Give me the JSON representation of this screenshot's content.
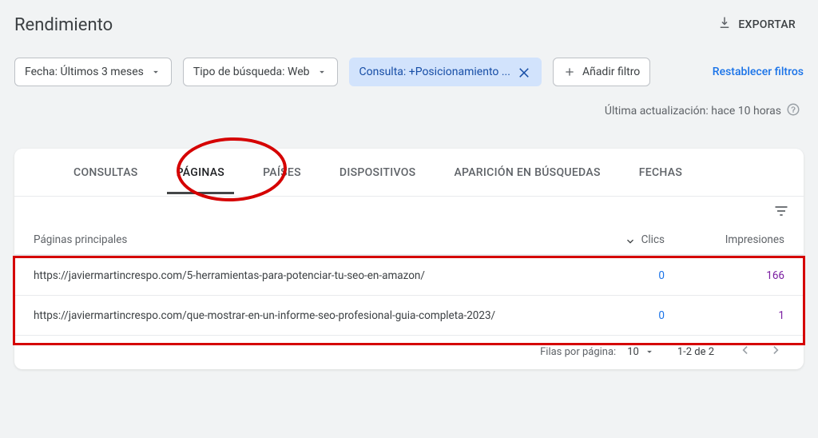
{
  "page_title": "Rendimiento",
  "export_label": "EXPORTAR",
  "filters": {
    "date": "Fecha: Últimos 3 meses",
    "search_type": "Tipo de búsqueda: Web",
    "query": "Consulta: +Posicionamiento ...",
    "add": "Añadir filtro",
    "reset": "Restablecer filtros"
  },
  "last_updated": "Última actualización: hace 10 horas",
  "tabs": {
    "consultas": "CONSULTAS",
    "paginas": "PÁGINAS",
    "paises": "PAÍSES",
    "dispositivos": "DISPOSITIVOS",
    "apariencia": "APARICIÓN EN BÚSQUEDAS",
    "fechas": "FECHAS"
  },
  "columns": {
    "page_col": "Páginas principales",
    "clics": "Clics",
    "impresiones": "Impresiones"
  },
  "rows": [
    {
      "url": "https://javiermartincrespo.com/5-herramientas-para-potenciar-tu-seo-en-amazon/",
      "clics": "0",
      "impresiones": "166"
    },
    {
      "url": "https://javiermartincrespo.com/que-mostrar-en-un-informe-seo-profesional-guia-completa-2023/",
      "clics": "0",
      "impresiones": "1"
    }
  ],
  "pager": {
    "rows_label": "Filas por página:",
    "rows_value": "10",
    "range": "1-2 de 2"
  }
}
